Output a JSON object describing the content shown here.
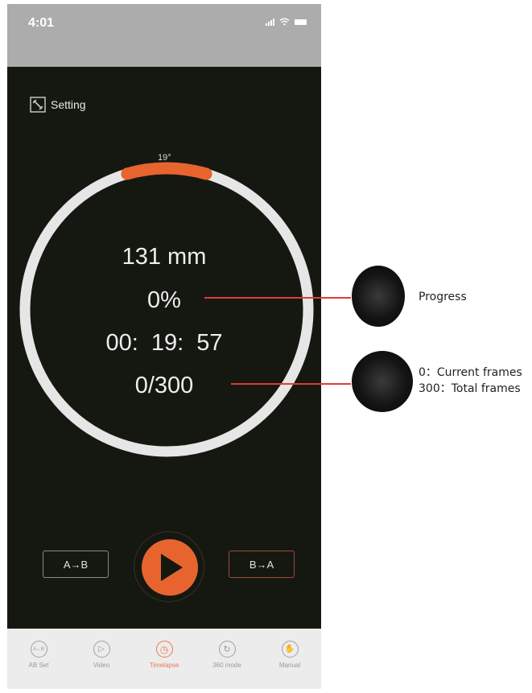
{
  "status_bar": {
    "time": "4:01"
  },
  "setting": {
    "label": "Setting"
  },
  "dial": {
    "angle_label": "19°",
    "position": "131 mm",
    "progress": "0%",
    "time_remaining": "00:  19:  57",
    "frames": "0/300",
    "ring_fill_fraction": 0.09
  },
  "controls": {
    "a_to_b": "A→B",
    "b_to_a": "B→A"
  },
  "tabs": [
    {
      "label": "AB Set",
      "icon": "ab-set-icon",
      "glyph": "A↔B",
      "active": false
    },
    {
      "label": "Video",
      "icon": "video-play-icon",
      "glyph": "▷",
      "active": false
    },
    {
      "label": "Timelapse",
      "icon": "clock-icon",
      "glyph": "◷",
      "active": true
    },
    {
      "label": "360 mode",
      "icon": "rotate-360-icon",
      "glyph": "↻",
      "active": false
    },
    {
      "label": "Manual",
      "icon": "manual-hand-icon",
      "glyph": "✋",
      "active": false
    }
  ],
  "annotations": {
    "progress": "Progress",
    "current_frames": "0：Current frames",
    "total_frames": "300：Total frames"
  },
  "colors": {
    "accent": "#e8642f",
    "ring": "#e6e6e6",
    "background": "#151811",
    "callout": "#e53935"
  }
}
